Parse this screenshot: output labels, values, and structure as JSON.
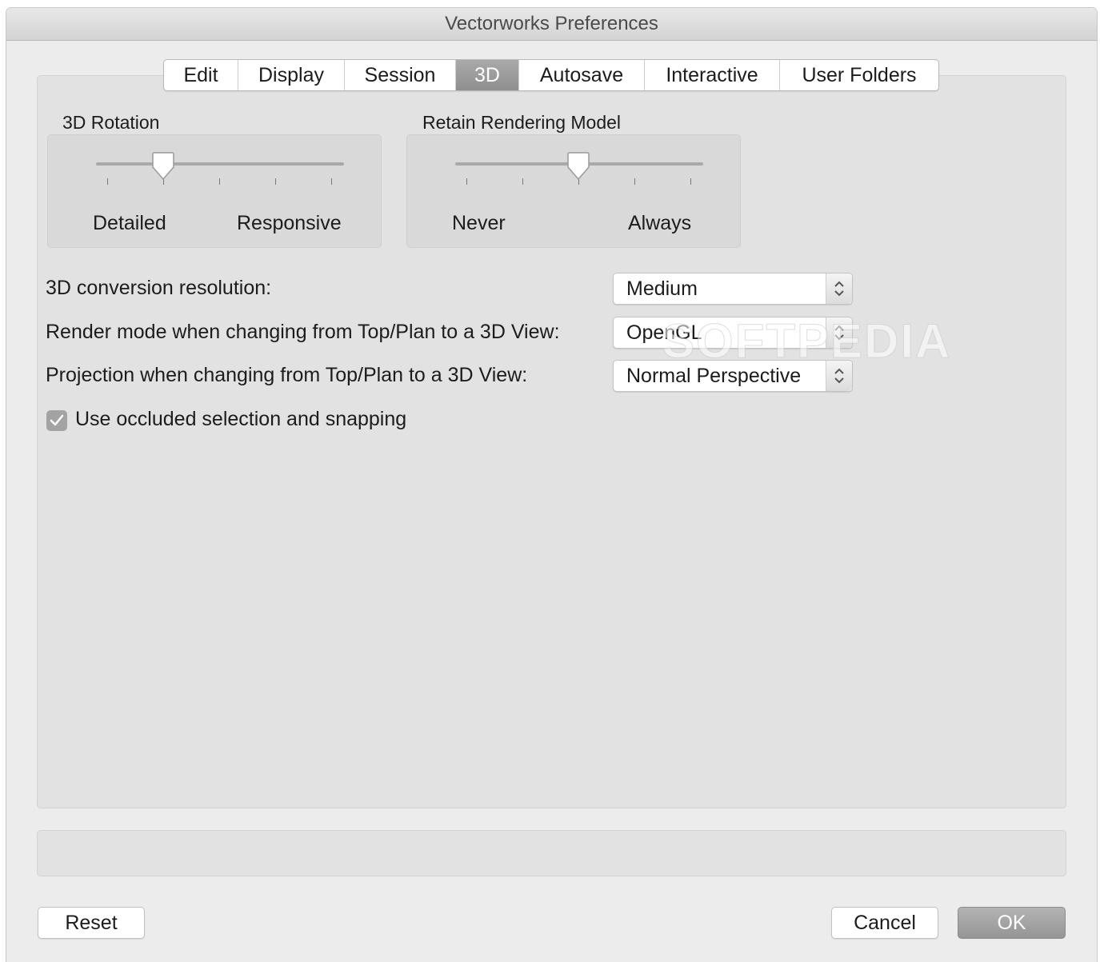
{
  "window": {
    "title": "Vectorworks Preferences"
  },
  "tabs": [
    {
      "label": "Edit",
      "selected": false
    },
    {
      "label": "Display",
      "selected": false
    },
    {
      "label": "Session",
      "selected": false
    },
    {
      "label": "3D",
      "selected": true
    },
    {
      "label": "Autosave",
      "selected": false
    },
    {
      "label": "Interactive",
      "selected": false
    },
    {
      "label": "User Folders",
      "selected": false
    }
  ],
  "rotation": {
    "label": "3D Rotation",
    "min_label": "Detailed",
    "max_label": "Responsive",
    "tick_count": 5,
    "selected_tick": 2
  },
  "retain": {
    "label": "Retain Rendering Model",
    "min_label": "Never",
    "max_label": "Always",
    "tick_count": 5,
    "selected_tick": 3
  },
  "settings": {
    "conversion": {
      "label": "3D conversion resolution:",
      "value": "Medium"
    },
    "render_mode": {
      "label": "Render mode when changing from Top/Plan to a 3D View:",
      "value": "OpenGL"
    },
    "projection": {
      "label": "Projection when changing from Top/Plan to a 3D View:",
      "value": "Normal Perspective"
    },
    "occluded": {
      "label": "Use occluded selection and snapping",
      "checked": true
    }
  },
  "buttons": {
    "reset": "Reset",
    "cancel": "Cancel",
    "ok": "OK"
  },
  "watermark": "SOFTPEDIA",
  "colors": {
    "selected_tab": "#9b9b9b",
    "default_button": "#a3a3a3",
    "checkbox": "#a3a3a3"
  }
}
